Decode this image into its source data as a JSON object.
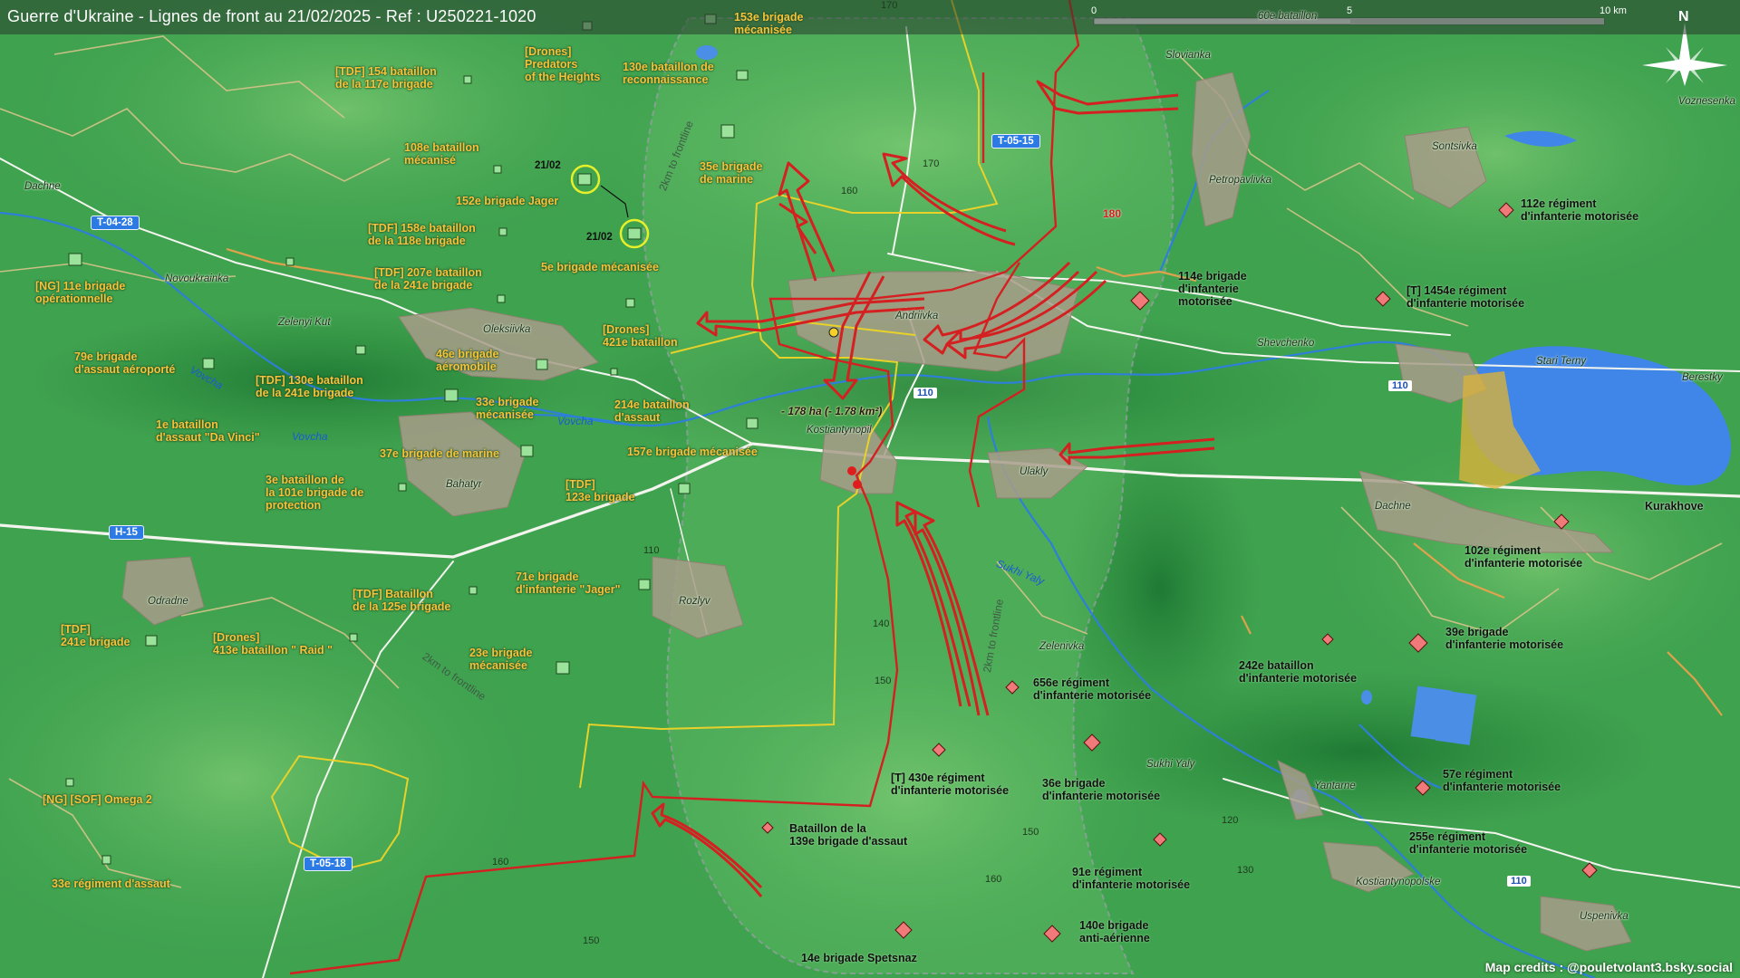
{
  "title": "Guerre d'Ukraine - Lignes de front au 21/02/2025 - Ref : U250221-1020",
  "credits": "Map credits : @pouletvolant3.bsky.social",
  "scale": {
    "s0": "0",
    "s5": "5",
    "s10": "10 km"
  },
  "north": "N",
  "roads": {
    "t0428": "T-04-28",
    "t0515": "T-05-15",
    "t0518": "T-05-18",
    "h15": "H-15",
    "r110a": "110",
    "r110b": "110",
    "r110c": "110"
  },
  "rivers": {
    "vovcha1": "Vovcha",
    "vovcha2": "Vovcha",
    "vovcha3": "Vovcha",
    "sukhi": "Sukhi Yaly"
  },
  "frontline_notes": {
    "a": "2km to frontline",
    "b": "2km to frontline",
    "c": "2km to frontline"
  },
  "area_note": "- 178 ha (- 1.78 km²)",
  "dates": {
    "d1": "21/02",
    "d2": "21/02"
  },
  "elev_180": "180",
  "contours": {
    "c170a": "170",
    "c160a": "160",
    "c170b": "170",
    "c110": "110",
    "c140": "140",
    "c150a": "150",
    "c160b": "160",
    "c150b": "150",
    "c120": "120",
    "c130": "130",
    "c160c": "160",
    "c150c": "150"
  },
  "towns": {
    "dachne_w": "Dachne",
    "novoukrainka": "Novoukrainka",
    "zelenyi_kut": "Zelenyi Kut",
    "oleksiivka": "Oleksiivka",
    "bahatyr": "Bahatyr",
    "odradne": "Odradne",
    "rozlyv": "Rozlyv",
    "andriivka": "Andriivka",
    "kostiantynopil": "Kostiantynopil",
    "ulakly": "Ulakly",
    "slovianka": "Slovianka",
    "petropavlivka": "Petropavlivka",
    "sontsivka": "Sontsivka",
    "shevchenko": "Shevchenko",
    "stari_terny": "Stari Terny",
    "berestky": "Berestky",
    "voznesenka": "Voznesenka",
    "dachne_e": "Dachne",
    "kurakhove": "Kurakhove",
    "zelenivka": "Zelenivka",
    "sukhi_yaly": "Sukhi Yaly",
    "yantarne": "Yantarne",
    "kostiantynopolske": "Kostiantynopolske",
    "uspenivka": "Uspenivka",
    "partial_top": "60e bataillon"
  },
  "units_uk": {
    "u153": "153e brigade\nmécanisée",
    "u130": "130e bataillon de\nreconnaissance",
    "udrones_pred": "[Drones]\nPredators\nof the Heights",
    "u154": "[TDF] 154 bataillon\nde la 117e brigade",
    "u108": "108e bataillon\nmécanisé",
    "u152": "152e brigade Jager",
    "u35": "35e brigade\nde marine",
    "u158": "[TDF] 158e bataillon\nde la 118e brigade",
    "u5": "5e brigade mécanisée",
    "u207": "[TDF] 207e bataillon\nde la 241e brigade",
    "u11ng": "[NG] 11e brigade\nopérationnelle",
    "u421": "[Drones]\n421e bataillon",
    "u79": "79e brigade\nd'assaut aéroporté",
    "u46": "46e brigade\naéromobile",
    "u130tdf": "[TDF] 130e bataillon\nde la 241e brigade",
    "u33": "33e brigade\nmécanisée",
    "u214": "214e bataillon\nd'assaut",
    "u1davinci": "1e bataillon\nd'assaut \"Da Vinci\"",
    "u37": "37e brigade de marine",
    "u157": "157e brigade mécanisée",
    "u3_101": "3e bataillon de\nla 101e brigade de\nprotection",
    "u123": "[TDF]\n123e brigade",
    "u71": "71e brigade\nd'infanterie \"Jager\"",
    "u125": "[TDF] Bataillon\nde la 125e brigade",
    "u241": "[TDF]\n241e brigade",
    "u413": "[Drones]\n413e bataillon \" Raid \"",
    "u23": "23e brigade\nmécanisée",
    "uomega": "[NG] [SOF] Omega 2",
    "u33reg": "33e régiment d'assaut"
  },
  "units_ru": {
    "r112": "112e régiment\nd'infanterie motorisée",
    "r114": "114e brigade\nd'infanterie\nmotorisée",
    "r1454": "[T] 1454e régiment\nd'infanterie motorisée",
    "r102": "102e régiment\nd'infanterie motorisée",
    "r39": "39e brigade\nd'infanterie motorisée",
    "r242": "242e bataillon\nd'infanterie motorisée",
    "r656": "656e régiment\nd'infanterie motorisée",
    "r430": "[T] 430e régiment\nd'infanterie motorisée",
    "r36": "36e brigade\nd'infanterie motorisée",
    "r57": "57e régiment\nd'infanterie motorisée",
    "r139": "Bataillon de la\n139e brigade d'assaut",
    "r255": "255e régiment\nd'infanterie motorisée",
    "r91": "91e régiment\nd'infanterie motorisée",
    "r140": "140e brigade\nanti-aérienne",
    "r14": "14e brigade Spetsnaz"
  },
  "colors": {
    "front": "#d42020",
    "yellow_line": "#e8d22a",
    "ua_unit": "#9be39a",
    "ru_unit": "#f07a7a",
    "label_yellow": "#f6c23b",
    "road": "#ffffff",
    "lake": "#3f86e8"
  }
}
